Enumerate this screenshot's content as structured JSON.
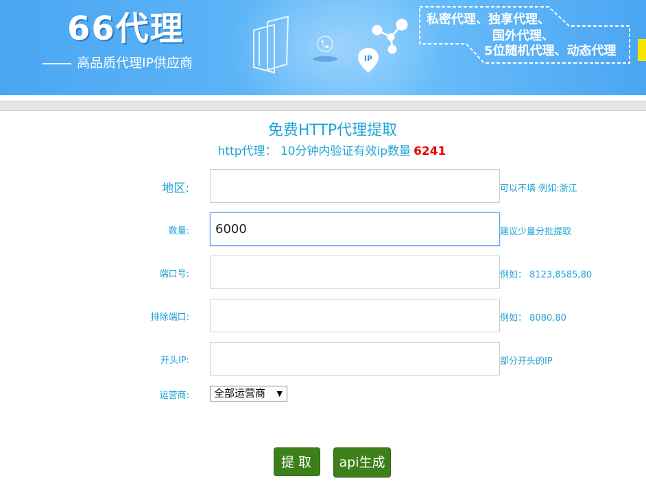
{
  "banner": {
    "logo_text": "66代理",
    "slogan": "高品质代理IP供应商",
    "promo_lines": [
      "私密代理、独享代理、",
      "国外代理、",
      "5位随机代理、动态代理"
    ],
    "ip_badge": "IP"
  },
  "header": {
    "title": "免费HTTP代理提取",
    "subtitle_prefix": "http代理： 10分钟内验证有效ip数量",
    "valid_count": "6241"
  },
  "form": {
    "region": {
      "label": "地区:",
      "value": "",
      "hint": "可以不填 例如:浙江"
    },
    "quantity": {
      "label": "数量:",
      "value": "6000",
      "hint": "建议少量分批提取"
    },
    "port": {
      "label": "端口号:",
      "value": "",
      "hint": "例如： 8123,8585,80"
    },
    "exclude_port": {
      "label": "排除端口:",
      "value": "",
      "hint": "例如： 8080,80"
    },
    "ip_prefix": {
      "label": "开头IP:",
      "value": "",
      "hint": "部分开头的IP"
    },
    "carrier": {
      "label": "运营商:",
      "selected": "全部运营商"
    }
  },
  "buttons": {
    "extract": "提取",
    "api": "api生成"
  },
  "colors": {
    "accent": "#1fa2d8",
    "count_red": "#ee0000",
    "button_green": "#3d7f1a",
    "banner_blue": "#4aa6f2"
  }
}
